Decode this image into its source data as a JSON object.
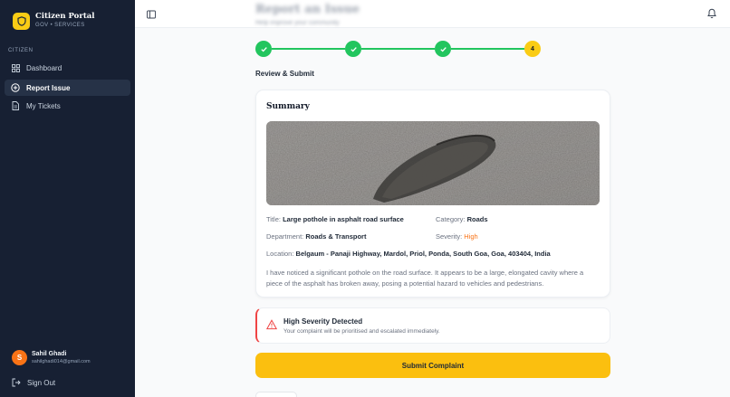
{
  "brand": {
    "title": "Citizen Portal",
    "subtitle": "GOV • SERVICES"
  },
  "sidebar": {
    "section_label": "CITIZEN",
    "items": [
      {
        "label": "Dashboard",
        "icon": "grid-icon"
      },
      {
        "label": "Report Issue",
        "icon": "plus-circle-icon",
        "active": true
      },
      {
        "label": "My Tickets",
        "icon": "document-icon"
      }
    ],
    "user": {
      "initial": "S",
      "name": "Sahil Ghadi",
      "email": "sahilghadi014@gmail.com"
    },
    "signout_label": "Sign Out"
  },
  "header": {
    "title": "Report an Issue",
    "subtitle": "Help improve your community"
  },
  "stepper": {
    "steps": [
      {
        "status": "done",
        "label": ""
      },
      {
        "status": "done",
        "label": ""
      },
      {
        "status": "done",
        "label": ""
      },
      {
        "status": "current",
        "label": "4"
      }
    ]
  },
  "review": {
    "heading": "Review & Submit",
    "card_title": "Summary",
    "fields": {
      "title_label": "Title:",
      "title_value": "Large pothole in asphalt road surface",
      "category_label": "Category:",
      "category_value": "Roads",
      "department_label": "Department:",
      "department_value": "Roads & Transport",
      "severity_label": "Severity:",
      "severity_value": "High",
      "location_label": "Location:",
      "location_value": "Belgaum - Panaji Highway, Mardol, Priol, Ponda, South Goa, Goa, 403404, India"
    },
    "description": "I have noticed a significant pothole on the road surface. It appears to be a large, elongated cavity where a piece of the asphalt has broken away, posing a potential hazard to vehicles and pedestrians."
  },
  "alert": {
    "title": "High Severity Detected",
    "text": "Your complaint will be prioritised and escalated immediately."
  },
  "submit_label": "Submit Complaint",
  "colors": {
    "sidebar_bg": "#172033",
    "accent": "#facc15",
    "success": "#22c55e",
    "severity_high": "#f97316",
    "danger": "#ef4444"
  }
}
